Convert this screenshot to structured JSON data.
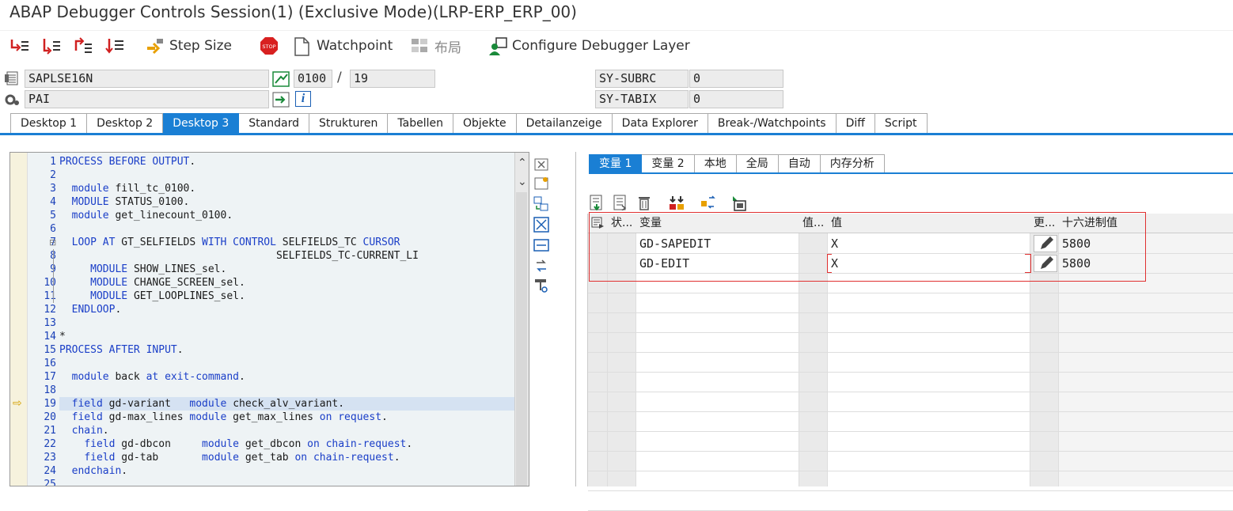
{
  "window": {
    "title": "ABAP Debugger Controls Session(1)  (Exclusive Mode)(LRP-ERP_ERP_00)"
  },
  "toolbar": {
    "step_size_label": "Step Size",
    "watchpoint_label": "Watchpoint",
    "layout_label": "布局",
    "configure_label": "Configure Debugger Layer",
    "stop_text": "STOP"
  },
  "fields": {
    "program": "SAPLSE16N",
    "event": "PAI",
    "screen": "0100",
    "separator": "/",
    "line": "19",
    "sy_subrc_label": "SY-SUBRC",
    "sy_subrc_value": "0",
    "sy_tabix_label": "SY-TABIX",
    "sy_tabix_value": "0",
    "info_glyph": "i"
  },
  "tabs": [
    "Desktop 1",
    "Desktop 2",
    "Desktop 3",
    "Standard",
    "Strukturen",
    "Tabellen",
    "Objekte",
    "Detailanzeige",
    "Data Explorer",
    "Break-/Watchpoints",
    "Diff",
    "Script"
  ],
  "active_tab": "Desktop 3",
  "editor": {
    "lines": [
      "PROCESS BEFORE OUTPUT.",
      "",
      "  module fill_tc_0100.",
      "  MODULE STATUS_0100.",
      "  module get_linecount_0100.",
      "",
      "  LOOP AT GT_SELFIELDS WITH CONTROL SELFIELDS_TC CURSOR",
      "                                   SELFIELDS_TC-CURRENT_LI",
      "     MODULE SHOW_LINES_sel.",
      "     MODULE CHANGE_SCREEN_sel.",
      "     MODULE GET_LOOPLINES_sel.",
      "  ENDLOOP.",
      "",
      "*",
      "PROCESS AFTER INPUT.",
      "",
      "  module back at exit-command.",
      "",
      "  field gd-variant   module check_alv_variant.",
      "  field gd-max_lines module get_max_lines on request.",
      "  chain.",
      "    field gd-dbcon     module get_dbcon on chain-request.",
      "    field gd-tab       module get_tab on chain-request.",
      "  endchain.",
      ""
    ],
    "current_line": 19,
    "collapse_glyph": "⊟",
    "arrow_glyph": "⇨",
    "scroll_up": "⌃",
    "scroll_down": "⌄"
  },
  "variables": {
    "tabs": [
      "变量 1",
      "变量 2",
      "本地",
      "全局",
      "自动",
      "内存分析"
    ],
    "active_tab": "变量 1",
    "columns": [
      "状...",
      "变量",
      "值...",
      "值",
      "更...",
      "十六进制值"
    ],
    "rows": [
      {
        "name": "GD-SAPEDIT",
        "value": "X",
        "hex": "5800"
      },
      {
        "name": "GD-EDIT",
        "value": "X",
        "hex": "5800"
      }
    ]
  },
  "colors": {
    "accent": "#1a7fd4",
    "highlight_box": "#e03030"
  }
}
